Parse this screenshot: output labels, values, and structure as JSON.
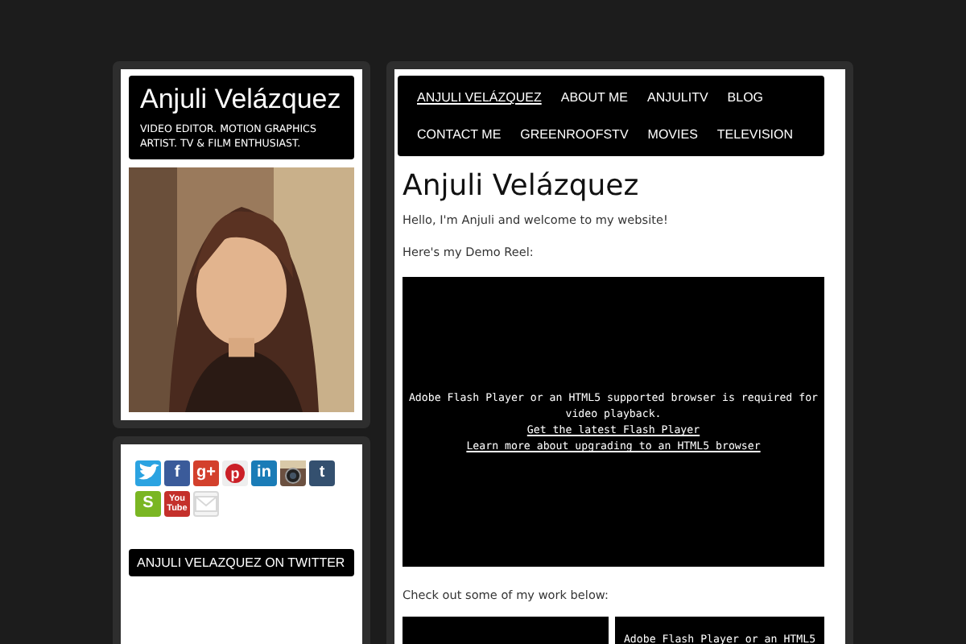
{
  "profile": {
    "name": "Anjuli Velázquez",
    "tagline": "VIDEO EDITOR. MOTION GRAPHICS ARTIST. TV & FILM ENTHUSIAST."
  },
  "social_icons": [
    {
      "kind": "bird",
      "color": "#2ba3e1"
    },
    {
      "kind": "letter",
      "text": "f",
      "color": "#3b5b9a"
    },
    {
      "kind": "letter",
      "text": "g+",
      "color": "#d3402c"
    },
    {
      "kind": "circle-letter",
      "text": "p",
      "color": "#cb2027"
    },
    {
      "kind": "letter",
      "text": "in",
      "color": "#1a7cb7"
    },
    {
      "kind": "camera",
      "color": "#6b5040"
    },
    {
      "kind": "letter",
      "text": "t",
      "color": "#34506f"
    },
    {
      "kind": "letter",
      "text": "S",
      "color": "#7ab623"
    },
    {
      "kind": "letter",
      "text": "You Tube",
      "color": "#c4302b"
    },
    {
      "kind": "envelope",
      "color": "#d8d8d8"
    }
  ],
  "twitter_heading": "ANJULI VELAZQUEZ ON TWITTER",
  "nav": [
    {
      "label": "ANJULI VELÁZQUEZ",
      "selected": true
    },
    {
      "label": "ABOUT ME",
      "selected": false
    },
    {
      "label": "ANJULITV",
      "selected": false
    },
    {
      "label": "BLOG",
      "selected": false
    },
    {
      "label": "CONTACT ME",
      "selected": false
    },
    {
      "label": "GREENROOFSTV",
      "selected": false
    },
    {
      "label": "MOVIES",
      "selected": false
    },
    {
      "label": "TELEVISION",
      "selected": false
    }
  ],
  "page_title": "Anjuli Velázquez",
  "intro": "Hello, I'm Anjuli and welcome to my website!",
  "reel_label": "Here's my Demo Reel:",
  "video": {
    "message": "Adobe Flash Player or an HTML5 supported browser is required for video playback.",
    "links": [
      "Get the latest Flash Player",
      "Learn more about upgrading to an HTML5 browser"
    ]
  },
  "work_label": "Check out some of my work below:",
  "work_videos": [
    {
      "kind": "blank"
    },
    {
      "kind": "message",
      "message": "Adobe Flash Player or an HTML5"
    }
  ]
}
